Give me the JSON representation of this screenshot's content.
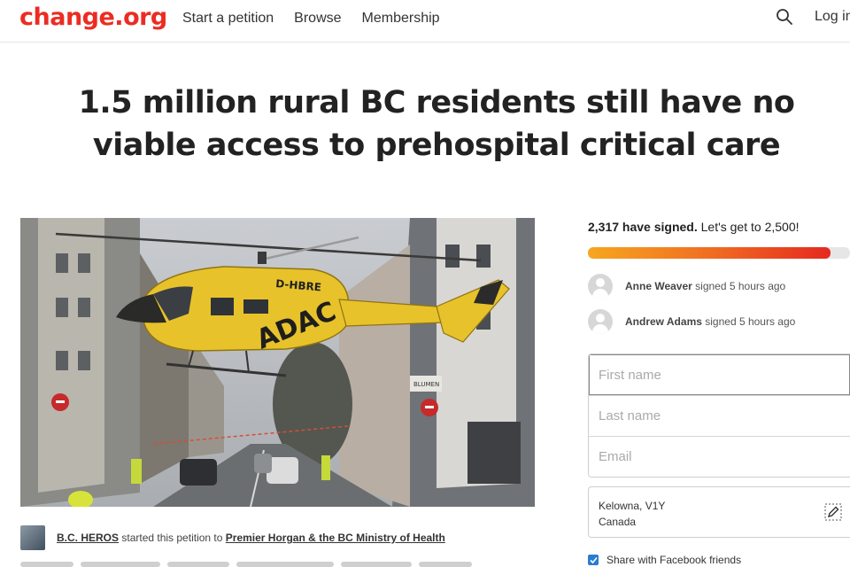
{
  "header": {
    "logo": "change.org",
    "nav": [
      "Start a petition",
      "Browse",
      "Membership"
    ],
    "login": "Log in"
  },
  "petition": {
    "title": "1.5 million rural BC residents still have no viable access to prehospital critical care",
    "image": {
      "helicopter_text_1": "D-HBRE",
      "helicopter_text_2": "ADAC",
      "sign_text": "BLUMEN"
    },
    "starter": {
      "name": "B.C. HEROS",
      "middle": "started this petition to",
      "target": "Premier Horgan & the BC Ministry of Health"
    }
  },
  "signing": {
    "count_bold": "2,317 have signed.",
    "goal_text": "Let's get to 2,500!",
    "progress_fraction": 0.927,
    "recent_signers": [
      {
        "name": "Anne Weaver",
        "action": "signed 5 hours ago"
      },
      {
        "name": "Andrew Adams",
        "action": "signed 5 hours ago"
      }
    ],
    "form": {
      "first_name_placeholder": "First name",
      "last_name_placeholder": "Last name",
      "email_placeholder": "Email",
      "location_line1": "Kelowna, V1Y",
      "location_line2": "Canada",
      "share_label": "Share with Facebook friends"
    }
  },
  "colors": {
    "brand": "#ec2c22",
    "progress_start": "#f7a620",
    "progress_end": "#e5291f",
    "checkbox": "#2b7bd3"
  }
}
